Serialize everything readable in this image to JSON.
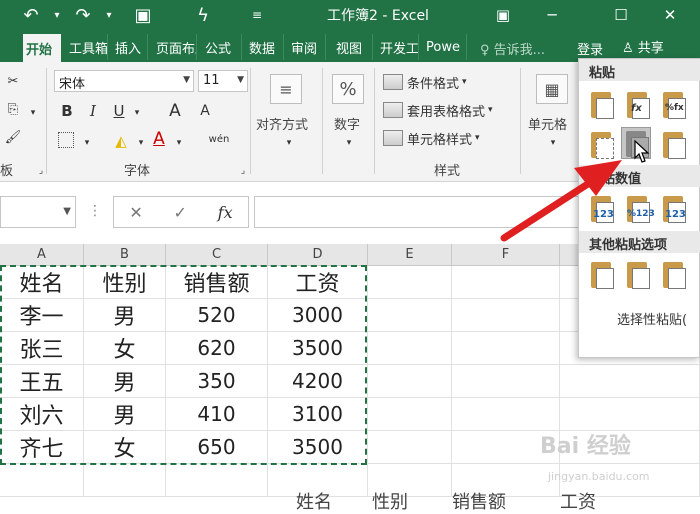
{
  "titlebar": {
    "title": "工作簿2 - Excel",
    "icons": [
      "undo-icon",
      "redo-icon",
      "camera-icon",
      "brush-icon",
      "customize-icon"
    ]
  },
  "tabs": [
    {
      "label": "开始",
      "active": true
    },
    {
      "label": "工具箱"
    },
    {
      "label": "插入"
    },
    {
      "label": "页面布局"
    },
    {
      "label": "公式"
    },
    {
      "label": "数据"
    },
    {
      "label": "审阅"
    },
    {
      "label": "视图"
    },
    {
      "label": "开发工具"
    },
    {
      "label": "Powe"
    }
  ],
  "tell_me": "告诉我...",
  "login": "登录",
  "share": "共享",
  "ribbon": {
    "font_name": "宋体",
    "font_size": "11",
    "bold": "B",
    "italic": "I",
    "underline": "U",
    "grow_font": "A",
    "shrink_font": "A",
    "font_color": "A",
    "phonetic": "wén",
    "font_group": "字体",
    "align_label": "对齐方式",
    "number_label": "数字",
    "percent": "%",
    "conditional_format": "条件格式",
    "table_format": "套用表格格式",
    "cell_style": "单元格样式",
    "style_group": "样式",
    "cells_label": "单元格",
    "left_group": "板"
  },
  "formula_bar": {
    "cancel": "✕",
    "enter": "✓",
    "fx": "fx"
  },
  "columns": [
    "A",
    "B",
    "C",
    "D",
    "E",
    "F"
  ],
  "table": [
    [
      "姓名",
      "性别",
      "销售额",
      "工资"
    ],
    [
      "李一",
      "男",
      "520",
      "3000"
    ],
    [
      "张三",
      "女",
      "620",
      "3500"
    ],
    [
      "王五",
      "男",
      "350",
      "4200"
    ],
    [
      "刘六",
      "男",
      "410",
      "3100"
    ],
    [
      "齐七",
      "女",
      "650",
      "3500"
    ]
  ],
  "bottom_row": [
    "姓名",
    "性别",
    "销售额",
    "工资"
  ],
  "paste_panel": {
    "paste": "粘贴",
    "paste_values": "粘贴数值",
    "other_options": "其他粘贴选项",
    "special": "选择性粘贴(",
    "labels": [
      "fx",
      "%fx",
      "123",
      "%123",
      "123"
    ]
  },
  "watermark": "Bai 经验",
  "watermark_sub": "jingyan.baidu.com"
}
